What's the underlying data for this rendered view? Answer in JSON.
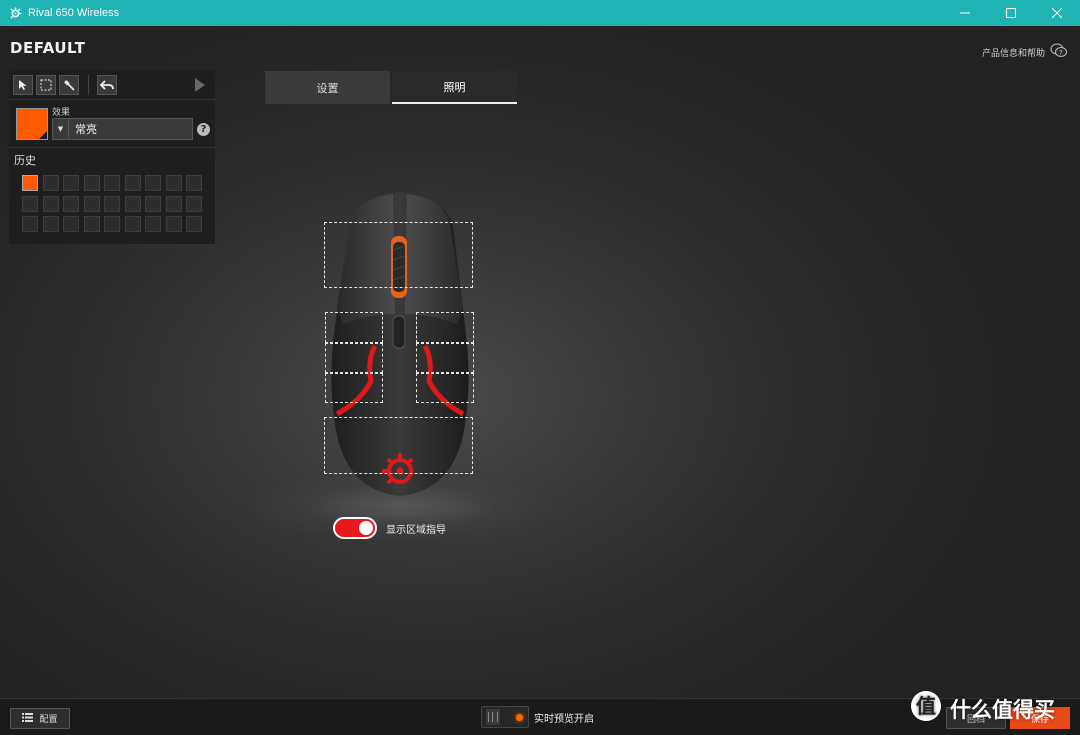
{
  "window": {
    "title": "Rival 650 Wireless",
    "controls": [
      "minimize",
      "maximize",
      "close"
    ]
  },
  "header": {
    "profile_name": "DEFAULT",
    "help_link": "产品信息和帮助"
  },
  "left_panel": {
    "tools": [
      "select-arrow-icon",
      "marquee-icon",
      "magic-wand-icon",
      "undo-icon"
    ],
    "effect_label": "效果",
    "effect_value": "常亮",
    "effect_color": "#ff5a00",
    "history_label": "历史",
    "history_swatches": [
      "#ff5a00"
    ]
  },
  "tabs": [
    {
      "label": "设置",
      "active": false
    },
    {
      "label": "照明",
      "active": true
    }
  ],
  "device": {
    "zone_guide_label": "显示区域指导",
    "zone_guide_on": true
  },
  "bottom": {
    "config_label": "配置",
    "live_preview_label": "实时预览开启",
    "revert_label": "回档",
    "save_label": "保存"
  },
  "watermark": {
    "text": "什么值得买"
  },
  "colors": {
    "titlebar": "#1fb3b3",
    "accent": "#ff5a00",
    "toggle_on": "#e51b1b"
  }
}
